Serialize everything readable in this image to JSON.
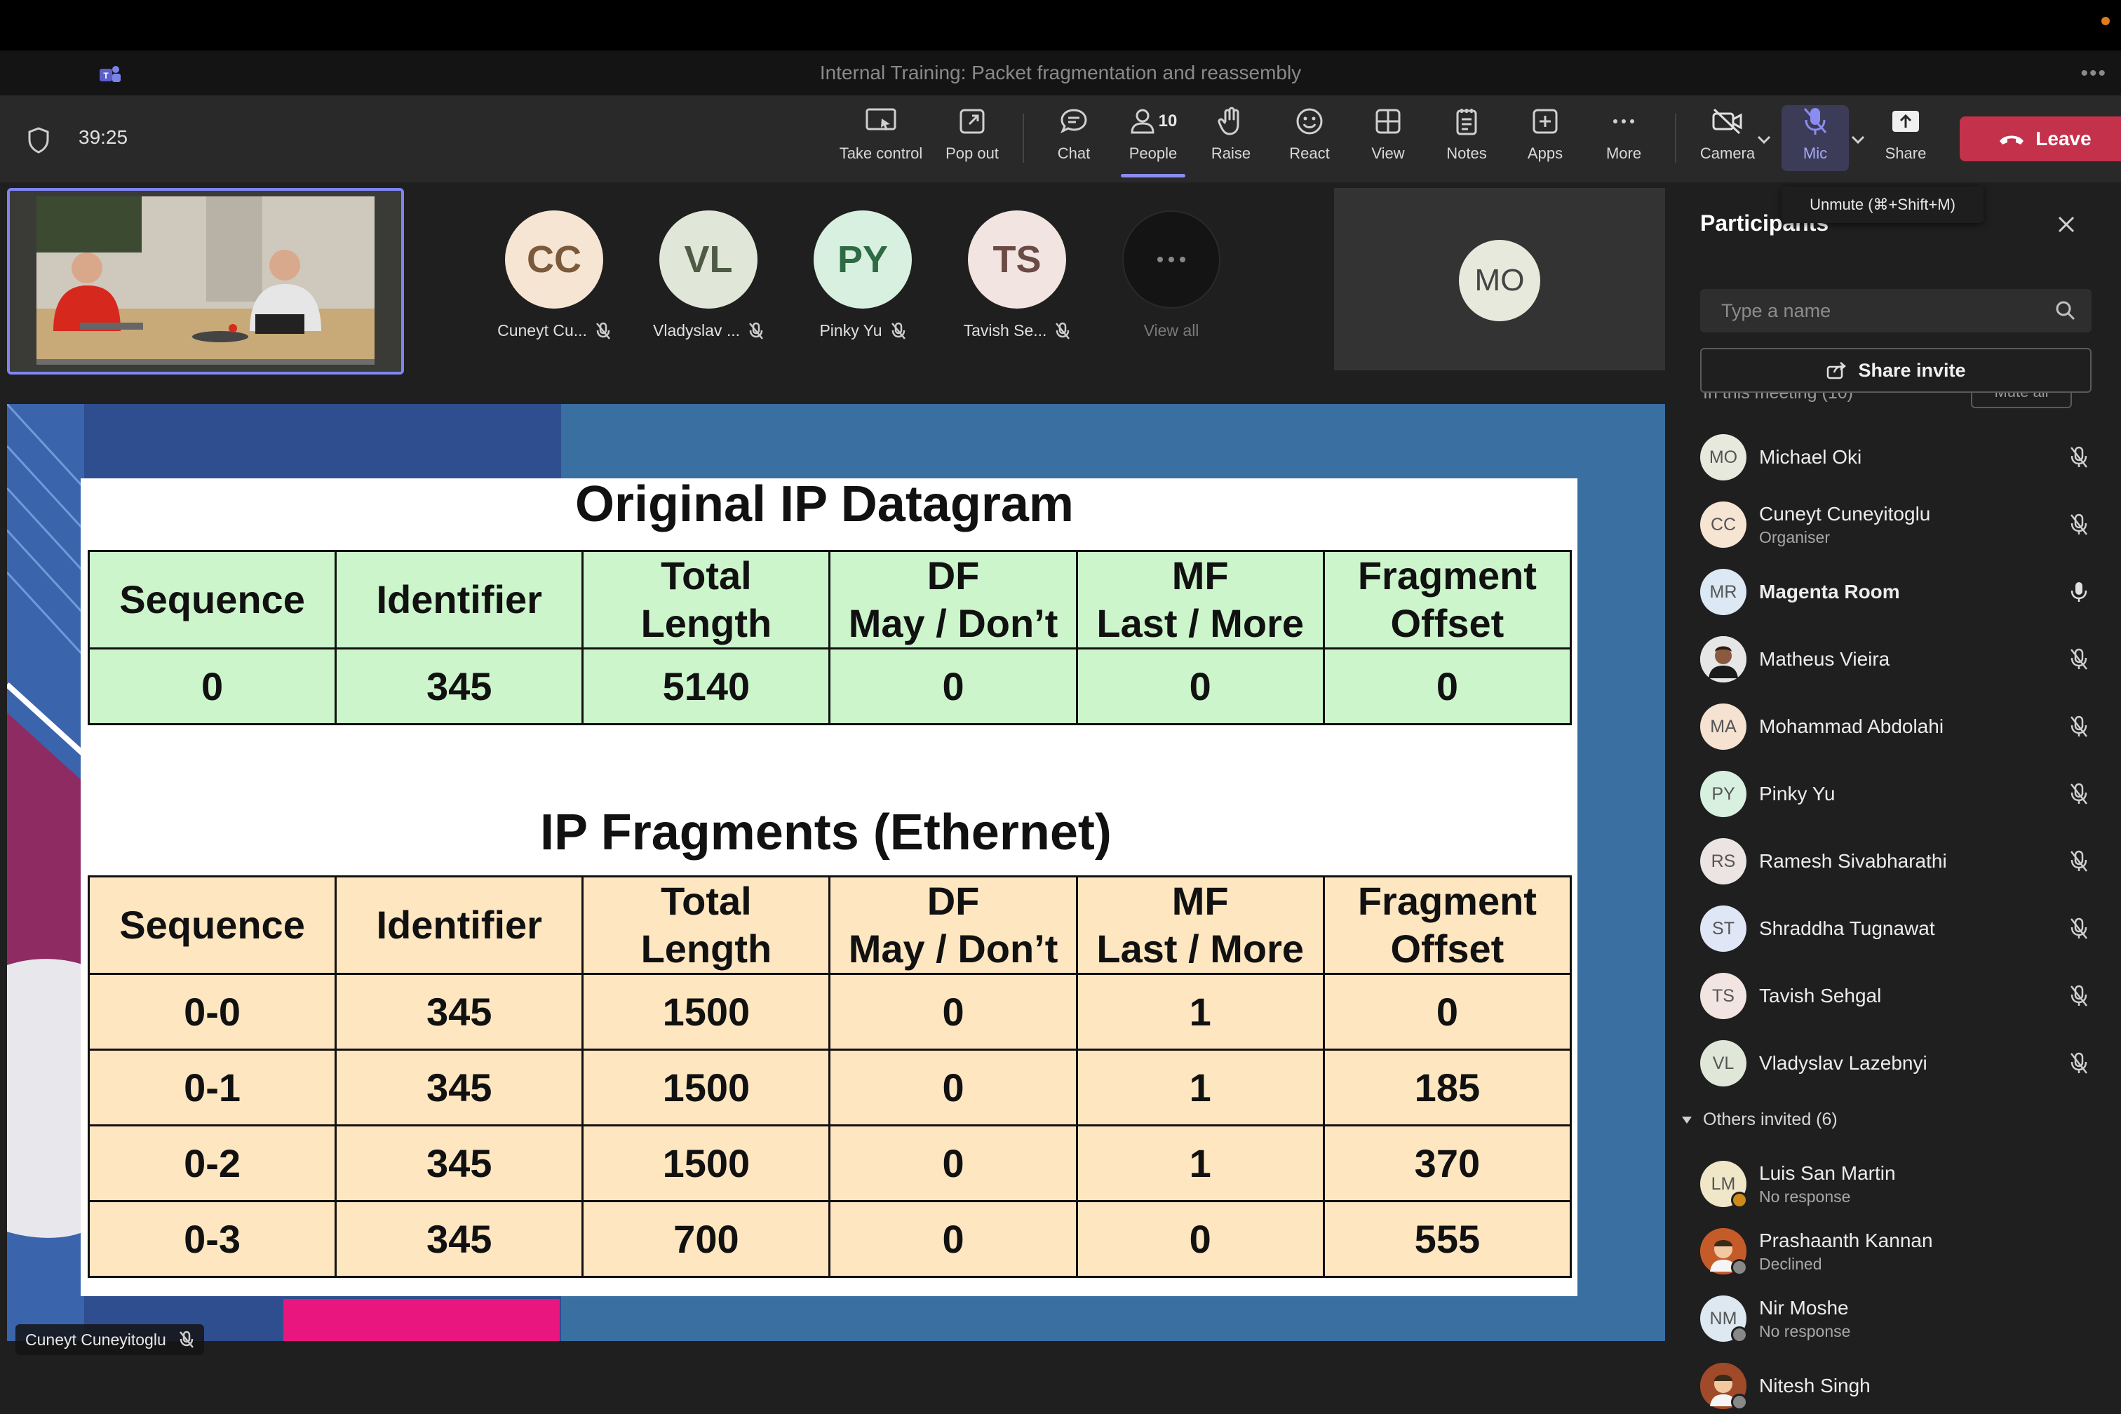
{
  "window": {
    "title": "Internal Training: Packet fragmentation and reassembly"
  },
  "meeting": {
    "timer": "39:25"
  },
  "toolbar": {
    "take_control": "Take control",
    "pop_out": "Pop out",
    "chat": "Chat",
    "people": "People",
    "people_count": "10",
    "raise": "Raise",
    "react": "React",
    "view": "View",
    "notes": "Notes",
    "apps": "Apps",
    "more": "More",
    "camera": "Camera",
    "mic": "Mic",
    "share": "Share",
    "leave": "Leave",
    "mic_tooltip": "Unmute (⌘+Shift+M)"
  },
  "gallery": {
    "tiles": [
      {
        "initials": "CC",
        "name": "Cuneyt Cu...",
        "bg": "#f7e5d4",
        "fg": "#7a5a3a"
      },
      {
        "initials": "VL",
        "name": "Vladyslav ...",
        "bg": "#e0e6d8",
        "fg": "#4e5a44"
      },
      {
        "initials": "PY",
        "name": "Pinky Yu",
        "bg": "#d8f0e0",
        "fg": "#2f6a45"
      },
      {
        "initials": "TS",
        "name": "Tavish Se...",
        "bg": "#f2e4e0",
        "fg": "#6a4a44"
      }
    ],
    "view_all": "View all",
    "large_tile_initials": "MO"
  },
  "slide": {
    "title1": "Original IP Datagram",
    "title2": "IP Fragments (Ethernet)",
    "headers": [
      [
        "Sequence"
      ],
      [
        "Identifier"
      ],
      [
        "Total",
        "Length"
      ],
      [
        "DF",
        "May / Don’t"
      ],
      [
        "MF",
        "Last / More"
      ],
      [
        "Fragment",
        "Offset"
      ]
    ],
    "original_row": [
      "0",
      "345",
      "5140",
      "0",
      "0",
      "0"
    ],
    "fragment_rows": [
      [
        "0-0",
        "345",
        "1500",
        "0",
        "1",
        "0"
      ],
      [
        "0-1",
        "345",
        "1500",
        "0",
        "1",
        "185"
      ],
      [
        "0-2",
        "345",
        "1500",
        "0",
        "1",
        "370"
      ],
      [
        "0-3",
        "345",
        "700",
        "0",
        "0",
        "555"
      ]
    ]
  },
  "speaker": {
    "name": "Cuneyt Cuneyitoglu"
  },
  "panel": {
    "title": "Participants",
    "search_placeholder": "Type a name",
    "share_invite": "Share invite",
    "in_meeting_cut": "In this meeting (10)",
    "mute_all_cut": "Mute all",
    "participants": [
      {
        "initials": "MO",
        "name": "Michael Oki",
        "sub": "",
        "bg": "#e6e9dc",
        "bold": false,
        "muted": true
      },
      {
        "initials": "CC",
        "name": "Cuneyt Cuneyitoglu",
        "sub": "Organiser",
        "bg": "#f7e5d4",
        "bold": false,
        "muted": true
      },
      {
        "initials": "MR",
        "name": "Magenta Room",
        "sub": "",
        "bg": "#dde8f5",
        "bold": true,
        "muted": false
      },
      {
        "initials": "",
        "name": "Matheus Vieira",
        "sub": "",
        "bg": "#e8e8e8",
        "bold": false,
        "muted": true,
        "photo": true
      },
      {
        "initials": "MA",
        "name": "Mohammad Abdolahi",
        "sub": "",
        "bg": "#f5e2d0",
        "bold": false,
        "muted": true
      },
      {
        "initials": "PY",
        "name": "Pinky Yu",
        "sub": "",
        "bg": "#d8f0e0",
        "bold": false,
        "muted": true
      },
      {
        "initials": "RS",
        "name": "Ramesh Sivabharathi",
        "sub": "",
        "bg": "#ece3e3",
        "bold": false,
        "muted": true
      },
      {
        "initials": "ST",
        "name": "Shraddha Tugnawat",
        "sub": "",
        "bg": "#dfe6f5",
        "bold": false,
        "muted": true
      },
      {
        "initials": "TS",
        "name": "Tavish Sehgal",
        "sub": "",
        "bg": "#f2e4e0",
        "bold": false,
        "muted": true
      },
      {
        "initials": "VL",
        "name": "Vladyslav Lazebnyi",
        "sub": "",
        "bg": "#e0e6d8",
        "bold": false,
        "muted": true
      }
    ],
    "others_invited": "Others invited (6)",
    "invited": [
      {
        "initials": "LM",
        "name": "Luis San Martin",
        "sub": "No response",
        "bg": "#f0e6c8",
        "status": "#d08a1a"
      },
      {
        "initials": "",
        "name": "Prashaanth Kannan",
        "sub": "Declined",
        "bg": "#c65b2a",
        "status": "#888888",
        "photo": true
      },
      {
        "initials": "NM",
        "name": "Nir Moshe",
        "sub": "No response",
        "bg": "#dde8f0",
        "status": "#888888"
      },
      {
        "initials": "",
        "name": "Nitesh Singh",
        "sub": "",
        "bg": "#a04a2a",
        "status": "#888888",
        "photo": true
      }
    ]
  },
  "colors": {
    "accent": "#7f85f5",
    "leave": "#c4314b",
    "slide_bg": "#3a6fa1",
    "highlight": "#e8167e"
  }
}
